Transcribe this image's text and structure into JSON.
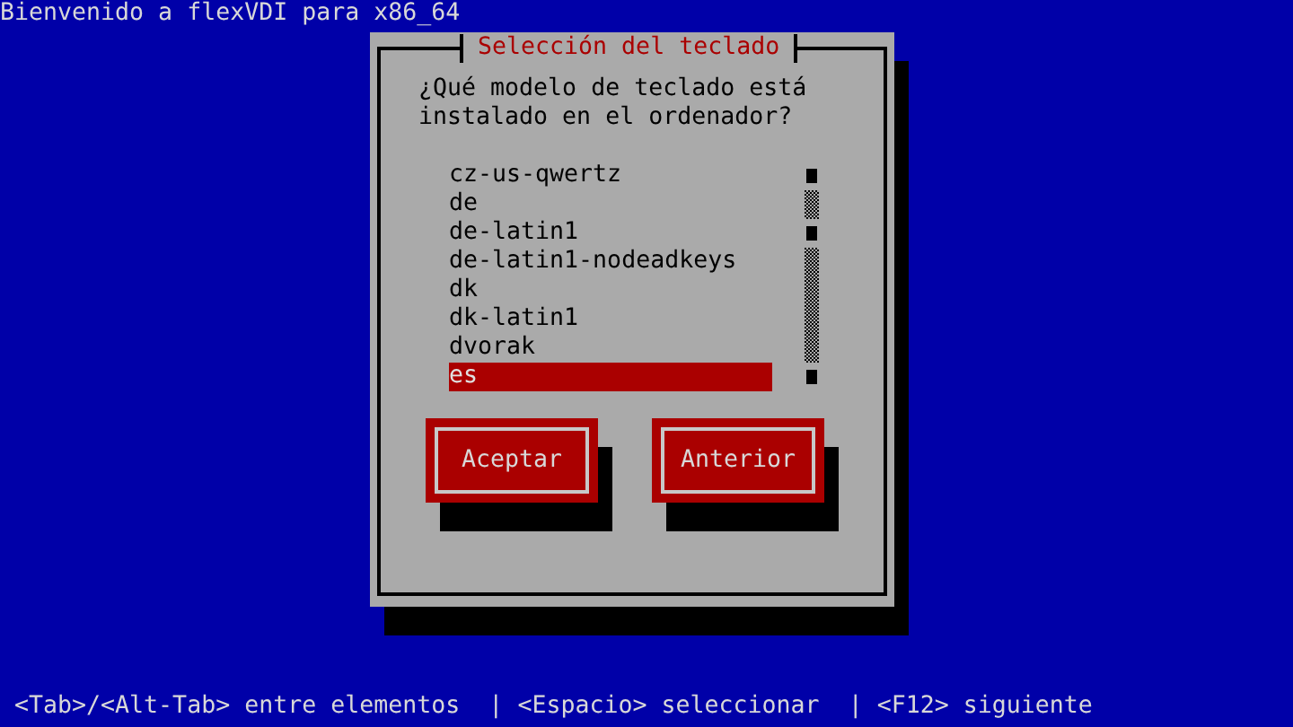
{
  "screen_title": "Bienvenido a flexVDI para x86_64",
  "dialog": {
    "title": "Selección del teclado",
    "question": "¿Qué modelo de teclado está instalado en el ordenador?",
    "items": [
      {
        "label": "cz-us-qwertz",
        "selected": false
      },
      {
        "label": "de",
        "selected": false
      },
      {
        "label": "de-latin1",
        "selected": false
      },
      {
        "label": "de-latin1-nodeadkeys",
        "selected": false
      },
      {
        "label": "dk",
        "selected": false
      },
      {
        "label": "dk-latin1",
        "selected": false
      },
      {
        "label": "dvorak",
        "selected": false
      },
      {
        "label": "es",
        "selected": true
      }
    ],
    "buttons": [
      "Aceptar",
      "Anterior"
    ]
  },
  "status_bar": "<Tab>/<Alt-Tab> entre elementos  | <Espacio> seleccionar  | <F12> siguiente"
}
